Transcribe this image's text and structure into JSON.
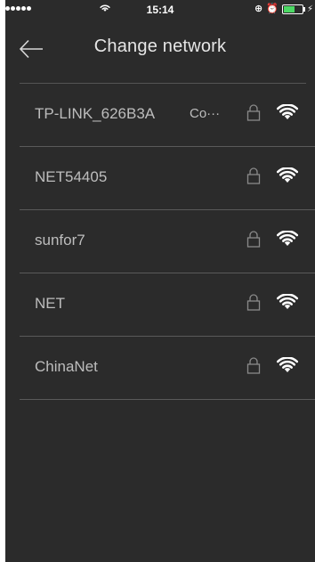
{
  "status_bar": {
    "time": "15:14",
    "signal_icon": "signal-dots-icon",
    "wifi_icon": "wifi-icon",
    "right_icons": [
      "rotation-lock-icon",
      "alarm-icon",
      "battery-icon",
      "charging-icon"
    ]
  },
  "header": {
    "title": "Change network",
    "back_icon": "back-arrow-icon"
  },
  "networks": [
    {
      "name": "TP-LINK_626B3A",
      "status": "Co···",
      "secured": true,
      "signal": "full"
    },
    {
      "name": "NET54405",
      "status": "",
      "secured": true,
      "signal": "full"
    },
    {
      "name": "sunfor7",
      "status": "",
      "secured": true,
      "signal": "full"
    },
    {
      "name": "NET",
      "status": "",
      "secured": true,
      "signal": "full"
    },
    {
      "name": "ChinaNet",
      "status": "",
      "secured": true,
      "signal": "full"
    }
  ],
  "colors": {
    "background": "#2b2b2b",
    "text": "#bdbdbd",
    "divider": "#5a5a5a",
    "battery": "#4cd964"
  }
}
